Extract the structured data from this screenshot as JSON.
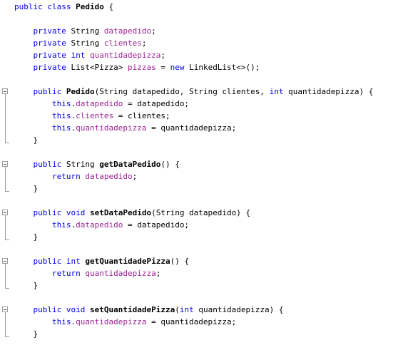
{
  "editor": {
    "lines": [
      [
        {
          "t": "public class ",
          "c": "kw"
        },
        {
          "t": "Pedido",
          "c": "method"
        },
        {
          "t": " {",
          "c": "plain"
        }
      ],
      [],
      [
        {
          "t": "    ",
          "c": "plain"
        },
        {
          "t": "private",
          "c": "kw"
        },
        {
          "t": " String ",
          "c": "plain"
        },
        {
          "t": "datapedido",
          "c": "field"
        },
        {
          "t": ";",
          "c": "plain"
        }
      ],
      [
        {
          "t": "    ",
          "c": "plain"
        },
        {
          "t": "private",
          "c": "kw"
        },
        {
          "t": " String ",
          "c": "plain"
        },
        {
          "t": "clientes",
          "c": "field"
        },
        {
          "t": ";",
          "c": "plain"
        }
      ],
      [
        {
          "t": "    ",
          "c": "plain"
        },
        {
          "t": "private int",
          "c": "kw"
        },
        {
          "t": " ",
          "c": "plain"
        },
        {
          "t": "quantidadepizza",
          "c": "field"
        },
        {
          "t": ";",
          "c": "plain"
        }
      ],
      [
        {
          "t": "    ",
          "c": "plain"
        },
        {
          "t": "private",
          "c": "kw"
        },
        {
          "t": " List<Pizza> ",
          "c": "plain"
        },
        {
          "t": "pizzas",
          "c": "field"
        },
        {
          "t": " = ",
          "c": "plain"
        },
        {
          "t": "new",
          "c": "kw"
        },
        {
          "t": " LinkedList<>();",
          "c": "plain"
        }
      ],
      [],
      [
        {
          "t": "    ",
          "c": "plain"
        },
        {
          "t": "public",
          "c": "kw"
        },
        {
          "t": " ",
          "c": "plain"
        },
        {
          "t": "Pedido",
          "c": "method"
        },
        {
          "t": "(String datapedido, String clientes, ",
          "c": "plain"
        },
        {
          "t": "int",
          "c": "kw"
        },
        {
          "t": " quantidadepizza) {",
          "c": "plain"
        }
      ],
      [
        {
          "t": "        ",
          "c": "plain"
        },
        {
          "t": "this",
          "c": "kw"
        },
        {
          "t": ".",
          "c": "plain"
        },
        {
          "t": "datapedido",
          "c": "field"
        },
        {
          "t": " = datapedido;",
          "c": "plain"
        }
      ],
      [
        {
          "t": "        ",
          "c": "plain"
        },
        {
          "t": "this",
          "c": "kw"
        },
        {
          "t": ".",
          "c": "plain"
        },
        {
          "t": "clientes",
          "c": "field"
        },
        {
          "t": " = clientes;",
          "c": "plain"
        }
      ],
      [
        {
          "t": "        ",
          "c": "plain"
        },
        {
          "t": "this",
          "c": "kw"
        },
        {
          "t": ".",
          "c": "plain"
        },
        {
          "t": "quantidadepizza",
          "c": "field"
        },
        {
          "t": " = quantidadepizza;",
          "c": "plain"
        }
      ],
      [
        {
          "t": "    }",
          "c": "plain"
        }
      ],
      [],
      [
        {
          "t": "    ",
          "c": "plain"
        },
        {
          "t": "public",
          "c": "kw"
        },
        {
          "t": " String ",
          "c": "plain"
        },
        {
          "t": "getDataPedido",
          "c": "method"
        },
        {
          "t": "() {",
          "c": "plain"
        }
      ],
      [
        {
          "t": "        ",
          "c": "plain"
        },
        {
          "t": "return",
          "c": "kw"
        },
        {
          "t": " ",
          "c": "plain"
        },
        {
          "t": "datapedido",
          "c": "field"
        },
        {
          "t": ";",
          "c": "plain"
        }
      ],
      [
        {
          "t": "    }",
          "c": "plain"
        }
      ],
      [],
      [
        {
          "t": "    ",
          "c": "plain"
        },
        {
          "t": "public void",
          "c": "kw"
        },
        {
          "t": " ",
          "c": "plain"
        },
        {
          "t": "setDataPedido",
          "c": "method"
        },
        {
          "t": "(String datapedido) {",
          "c": "plain"
        }
      ],
      [
        {
          "t": "        ",
          "c": "plain"
        },
        {
          "t": "this",
          "c": "kw"
        },
        {
          "t": ".",
          "c": "plain"
        },
        {
          "t": "datapedido",
          "c": "field"
        },
        {
          "t": " = datapedido;",
          "c": "plain"
        }
      ],
      [
        {
          "t": "    }",
          "c": "plain"
        }
      ],
      [],
      [
        {
          "t": "    ",
          "c": "plain"
        },
        {
          "t": "public int",
          "c": "kw"
        },
        {
          "t": " ",
          "c": "plain"
        },
        {
          "t": "getQuantidadePizza",
          "c": "method"
        },
        {
          "t": "() {",
          "c": "plain"
        }
      ],
      [
        {
          "t": "        ",
          "c": "plain"
        },
        {
          "t": "return",
          "c": "kw"
        },
        {
          "t": " ",
          "c": "plain"
        },
        {
          "t": "quantidadepizza",
          "c": "field"
        },
        {
          "t": ";",
          "c": "plain"
        }
      ],
      [
        {
          "t": "    }",
          "c": "plain"
        }
      ],
      [],
      [
        {
          "t": "    ",
          "c": "plain"
        },
        {
          "t": "public void",
          "c": "kw"
        },
        {
          "t": " ",
          "c": "plain"
        },
        {
          "t": "setQuantidadePizza",
          "c": "method"
        },
        {
          "t": "(",
          "c": "plain"
        },
        {
          "t": "int",
          "c": "kw"
        },
        {
          "t": " quantidadepizza) {",
          "c": "plain"
        }
      ],
      [
        {
          "t": "        ",
          "c": "plain"
        },
        {
          "t": "this",
          "c": "kw"
        },
        {
          "t": ".",
          "c": "plain"
        },
        {
          "t": "quantidadepizza",
          "c": "field"
        },
        {
          "t": " = quantidadepizza;",
          "c": "plain"
        }
      ],
      [
        {
          "t": "    }",
          "c": "plain"
        }
      ]
    ],
    "colors": {
      "keyword": "#0000e6",
      "field": "#9b2393",
      "text": "#000000",
      "fold_marker": "#9a9a9a"
    },
    "icons": [
      "fold-collapse-icon"
    ]
  }
}
